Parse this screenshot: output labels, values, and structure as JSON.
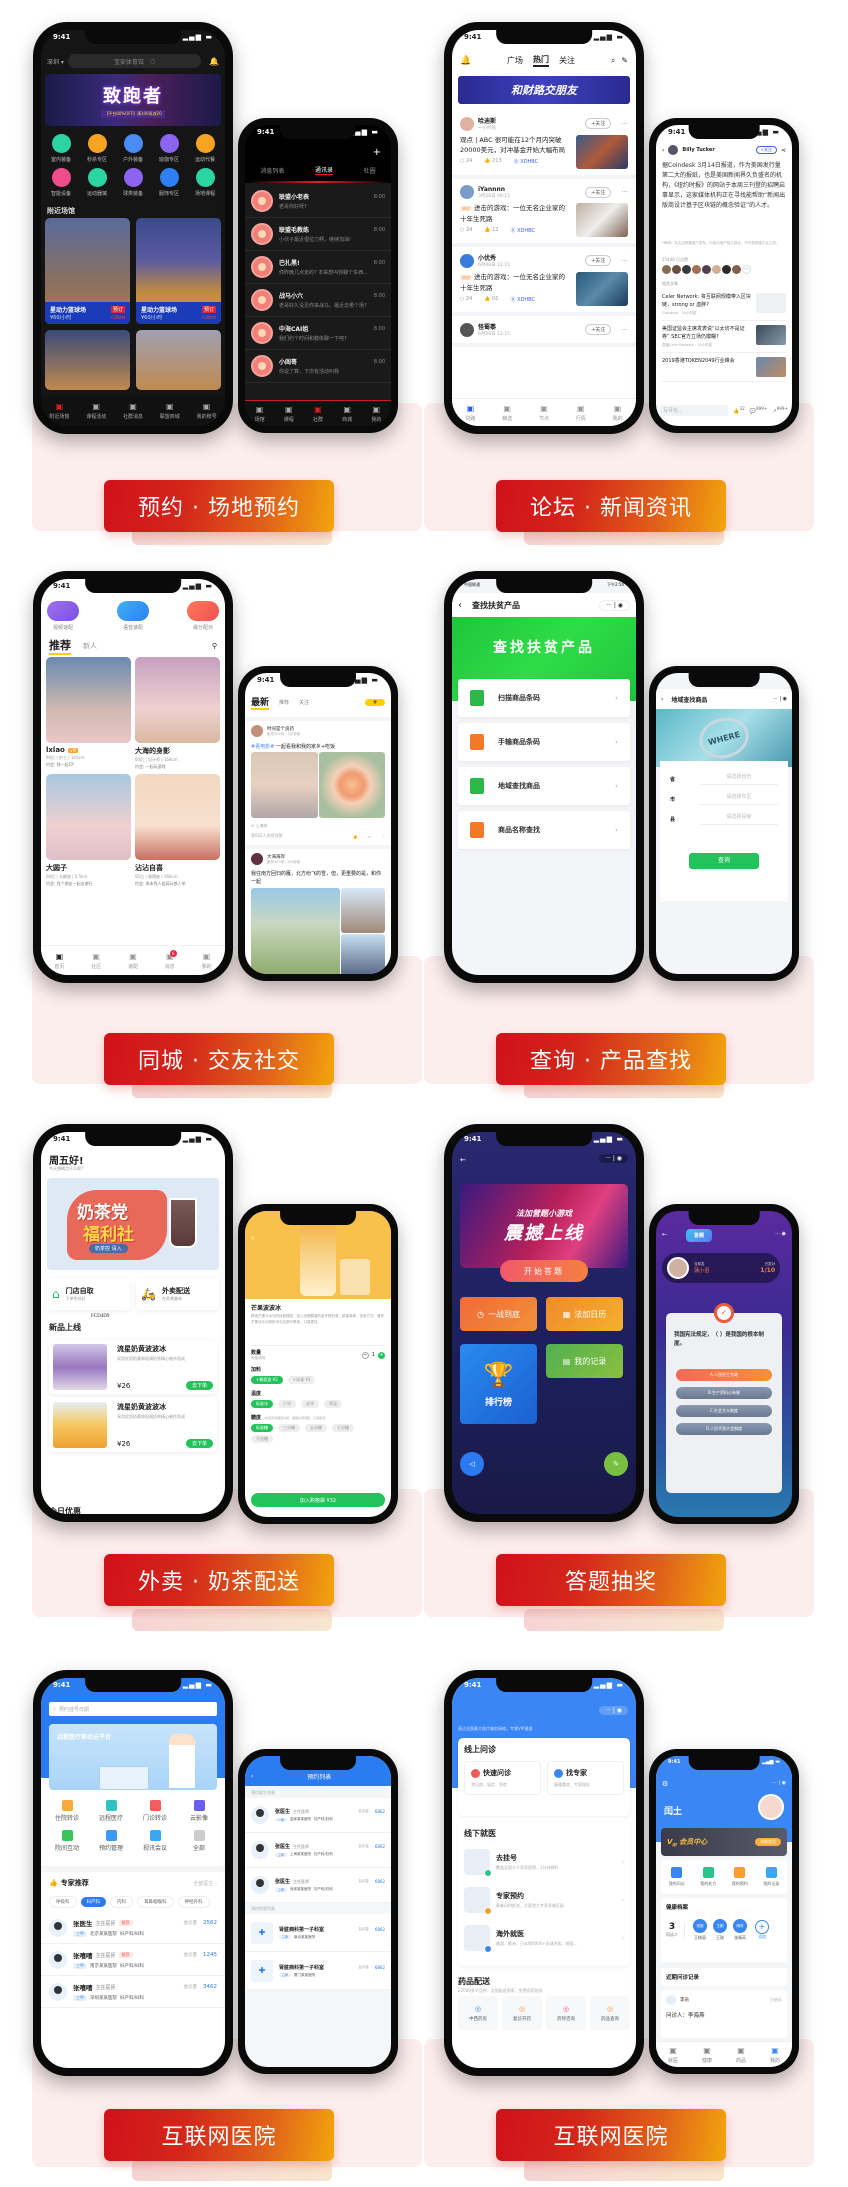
{
  "status_time": "9:41",
  "cards": {
    "booking": {
      "banner_label": "预约 · 场地预约",
      "main": {
        "city": "深圳 ▾",
        "search_placeholder": "宝安体育馆",
        "hero_title": "致跑者",
        "hero_sub": "【平台80%OFF】满100再减20",
        "categories": [
          "室内装备",
          "秒杀专区",
          "户外装备",
          "瑜伽专区",
          "运动代餐",
          "智能设备",
          "运动器械",
          "球类装备",
          "服饰专区",
          "场地课程"
        ],
        "category_colors": [
          "#2bd4a0",
          "#f7a420",
          "#4a8bf5",
          "#8c64f0",
          "#f7a420",
          "#f04b8a",
          "#2bd4a0",
          "#8c64f0",
          "#2f7ef5",
          "#2bd4a0"
        ],
        "section_title": "附近场馆",
        "venues": [
          {
            "name": "星动力篮球场",
            "price": "¥60/小时",
            "badge": "预订",
            "distance": "<2km"
          },
          {
            "name": "星动力篮球场",
            "price": "¥60/小时",
            "badge": "预订",
            "distance": "<2km"
          }
        ],
        "tabs": [
          "附近场馆",
          "课程活动",
          "社群消息",
          "联盟商城",
          "我的账号"
        ]
      },
      "side": {
        "tabs": [
          "消息列表",
          "通讯录",
          "社圈"
        ],
        "messages": [
          {
            "name": "联盟小老表",
            "text": "老哥你好呀?",
            "time": "8:00"
          },
          {
            "name": "联盟毛教练",
            "text": "小伙子最近很拉力啊，继续加油!",
            "time": "8:00"
          },
          {
            "name": "巴扎黑!",
            "text": "你昨晚几点走的? 本来想叫你聊个东西...",
            "time": "8:00"
          },
          {
            "name": "战马小六",
            "text": "老哥好久没见你来战马，最近去哪个场?",
            "time": "8:00"
          },
          {
            "name": "中海CAI姐",
            "text": "我们约个时间和教练聊一下吧?",
            "time": "8:00"
          },
          {
            "name": "小阎哥",
            "text": "你说了算，下次有活动叫我",
            "time": "8:00"
          }
        ],
        "tabs_bottom": [
          "场馆",
          "课程",
          "社群",
          "商城",
          "我的"
        ]
      }
    },
    "news": {
      "banner_label": "论坛 · 新闻资讯",
      "main": {
        "tabs": [
          "广场",
          "热门",
          "关注"
        ],
        "hero_title": "和财路交朋友",
        "follow_label": "+关注",
        "posts": [
          {
            "user": "哈迪斯",
            "time": "一小时前",
            "title": "观点 | ABC 很可能在12个月内突破20000美元，对冲基金开始大幅布局",
            "comments": "24",
            "likes": "213",
            "tag": "XDHBC"
          },
          {
            "user": "iYannnn",
            "time": "3月28日 09:15",
            "title": "进击的游戏：一位无名企业家的十年生死路",
            "label": "原创",
            "comments": "24",
            "likes": "12",
            "tag": "XDHBC"
          },
          {
            "user": "小优秀",
            "time": "6月08日 12:15",
            "title": "进击的游戏：一位无名企业家的十年生死路",
            "label": "原创",
            "comments": "24",
            "likes": "00",
            "tag": "XDHBC"
          },
          {
            "user": "怪蜀黍",
            "time": "6月08日 12:15"
          }
        ],
        "tabs_bottom": [
          "财路",
          "精选",
          "节点",
          "行情",
          "我的"
        ]
      },
      "side": {
        "author": "Billy Tucker",
        "follow_label": "+关注",
        "body": "据Coindesk 3月14日报道，作为美国发行量第二大的报纸，也是美国新闻界久负盛名的机构，《纽约时报》的网站于本周三刊登的招聘启事显示，这家媒体机构正在寻找能帮助“新闻出版商设计基于区块链的概念验证”的人才。",
        "disclaimer": "*声明：本文由财路用户发布，内容为用户独立观点，不代表财路平台立场。",
        "likes_count": "25440 已点赞",
        "related_title": "相关文章",
        "related": [
          {
            "title": "Celer Network: 将互联网规模带入区块链，strong or 虚胖?",
            "meta": "Cloudsun · 10小时前"
          },
          {
            "title": "美国证监会主席发表说“以太坊不是证券” SEC官方立场仍模糊?",
            "meta": "直播Celer Network · 10小时前"
          },
          {
            "title": "2019香港TOKEN2049行业峰会",
            "meta": ""
          }
        ],
        "comment_placeholder": "写评论...",
        "like_count": "32",
        "comment_count": "999+",
        "share_count": "999+"
      }
    },
    "social": {
      "banner_label": "同城 · 交友社交",
      "main": {
        "quick": [
          "视频速配",
          "语音速配",
          "缘分配对"
        ],
        "tabs": [
          "推荐",
          "新人"
        ],
        "profiles": [
          {
            "name": "lxlao",
            "vip": "VIP",
            "info": "90后 | 护士 | 165cm",
            "date": "约会: 找一起CP"
          },
          {
            "name": "大海的身影",
            "info": "00后 | 设计师 | 168cm",
            "date": "约会: 一起玩游戏"
          },
          {
            "name": "大圆子",
            "info": "00后 | 天蝎座 | 0.5km",
            "date": "约会: 找个朋友一起去旅行"
          },
          {
            "name": "沾沾自喜",
            "info": "95后 | 摩羯座 | 166cm",
            "date": "约会: 周末找人组局玩狼人杀"
          }
        ],
        "tabs_bottom": [
          "首页",
          "社区",
          "速配",
          "消息",
          "我的"
        ],
        "message_badge": "6"
      },
      "side": {
        "tabs": [
          "最新",
          "推荐",
          "关注"
        ],
        "post1": {
          "user": "时间是个良药",
          "meta": "距您300米 · 3分钟前",
          "hashtag": "#看电影#",
          "text": "一起看我和我的家乡+吃饭",
          "location": "上海市",
          "likes": "等602人觉得很赞"
        },
        "post2": {
          "user": "大海海岸",
          "meta": "距你403米 · 4分钟前",
          "text": "我往南方回归的雁，北方纷飞的雪，但，更重要的是，和你一起"
        }
      }
    },
    "search": {
      "banner_label": "查询 · 产品查找",
      "main": {
        "carrier": "中国联通",
        "clock": "下午2:56",
        "title": "查找扶贫产品",
        "hero": "查找扶贫产品",
        "items": [
          {
            "label": "扫描商品条码",
            "color": "#2db84a"
          },
          {
            "label": "手输商品条码",
            "color": "#f07a2a"
          },
          {
            "label": "地域查找商品",
            "color": "#2db84a"
          },
          {
            "label": "商品名称查找",
            "color": "#f07a2a"
          }
        ]
      },
      "side": {
        "title": "地域查找商品",
        "hero_text": "WHERE",
        "fields": [
          {
            "label": "省",
            "placeholder": "请选择省份"
          },
          {
            "label": "市",
            "placeholder": "请选择市区"
          },
          {
            "label": "县",
            "placeholder": "请选择县级"
          }
        ],
        "submit": "查询"
      }
    },
    "milktea": {
      "banner_label": "外卖 · 奶茶配送",
      "main": {
        "greeting": "周五好!",
        "sub": "今天想喝点什么呢?",
        "hero_line1": "奶茶党",
        "hero_line2": "福利社",
        "hero_btn": "奶茶控 请入",
        "services": [
          {
            "title": "门店自取",
            "sub": "下单免排队"
          },
          {
            "title": "外卖配送",
            "sub": "在家喝美味"
          }
        ],
        "code": "FCD4D9",
        "new_title": "新品上线",
        "products": [
          {
            "name": "流星奶黄波波冰",
            "desc": "采用优质奶黄和现调奶茶精心制作而成",
            "price": "¥26",
            "cta": "去下单"
          },
          {
            "name": "流星奶黄波波冰",
            "desc": "采用优质奶黄和现调奶茶精心制作而成",
            "price": "¥26",
            "cta": "去下单"
          }
        ],
        "today_title": "今日优惠"
      },
      "side": {
        "name": "芒果波波冰",
        "desc": "精选芒果与冰沙的经典搭配，加入浓郁醇香的茅牙鲜奶底，甜蜜味美，饮用方式：搅拌芒果冰沙与鲜奶均匀后即可享用，口感更佳。",
        "qty_label": "数量",
        "qty_sub": "规格说明",
        "qty": "1",
        "addon_label": "加料",
        "addons": [
          "+椰浆波 ¥2",
          "+珍珠 ¥3"
        ],
        "temp_label": "温度",
        "temps": [
          "标准冰",
          "少冰",
          "去冰",
          "常温"
        ],
        "sugar_label": "糖度",
        "sugar_note": "(本店所有糖度均按，酸甜比例调配，口感更佳)",
        "sugars": [
          "标准糖",
          "三分糖",
          "五分糖",
          "七分糖",
          "不加糖"
        ],
        "cart": "加入购物袋 ¥32"
      }
    },
    "quiz": {
      "banner_label": "答题抽奖",
      "main": {
        "hero_small": "法加营题小游戏",
        "hero_big": "震撼上线",
        "start": "开始答题",
        "tiles": [
          "一战到底",
          "法加日历",
          "排行榜",
          "我的记录"
        ]
      },
      "side": {
        "header": "答题",
        "user_label": "当前答",
        "user_name": "蒲小泪",
        "progress_label": "已答对",
        "progress": "1/10",
        "question": "我国宪法规定，（ ）是我国的根本制度。",
        "options": [
          "A.人民民主专政",
          "B.生产资料公有制",
          "C.社会主义制度",
          "D.人民代表大会制度"
        ]
      }
    },
    "hospital1": {
      "banner_label": "互联网医院",
      "main": {
        "search_placeholder": "预约挂号日期",
        "hero_title": "远程医疗移动云平台",
        "services": [
          "住院转诊",
          "远程医疗",
          "门诊转诊",
          "云影像",
          "院间互动",
          "预约管理",
          "视讯会议",
          "全部"
        ],
        "service_colors": [
          "#f7a93b",
          "#2ec4c4",
          "#f25e5e",
          "#6a5ef0",
          "#3cc35a",
          "#3a9af5",
          "#3aa7f0",
          "#cccccc"
        ],
        "expert_title": "专家推荐",
        "all_link": "全部医生",
        "departments": [
          "呼吸科",
          "妇产科",
          "内科",
          "耳鼻咽喉科",
          "神经外科"
        ],
        "doctors": [
          {
            "name": "张医生",
            "title": "主任医师",
            "tag": "推荐",
            "count_label": "会诊量",
            "count": "2562",
            "level": "三甲",
            "hospital": "北京某某医院",
            "dept": "妇产科/妇科"
          },
          {
            "name": "张嘻嘻",
            "title": "主任医师",
            "tag": "推荐",
            "count_label": "会诊量",
            "count": "1245",
            "level": "三甲",
            "hospital": "南京某某医院",
            "dept": "妇产科/妇科"
          },
          {
            "name": "张嘻嘻",
            "title": "主任医师",
            "count_label": "会诊量",
            "count": "3462",
            "level": "三甲",
            "hospital": "深圳某某医院",
            "dept": "妇产科/妇科"
          }
        ]
      },
      "side": {
        "title": "预约列表",
        "doctor_section": "预约医生列表",
        "doctors": [
          {
            "name": "张医生",
            "title": "主任医师",
            "count": "6862",
            "level": "一甲",
            "hospital": "金家某某医院",
            "dept": "妇产科/妇科"
          },
          {
            "name": "张医生",
            "title": "主任医师",
            "count": "6862",
            "level": "三甲",
            "hospital": "上海某某医院",
            "dept": "妇产科/妇科"
          },
          {
            "name": "张医生",
            "title": "主任医师",
            "count": "6862",
            "level": "三甲",
            "hospital": "深圳某某医院",
            "dept": "妇产科/妇科"
          }
        ],
        "room_section": "预约科室列表",
        "rooms": [
          {
            "name": "肾脏病科第一子科室",
            "count": "6862",
            "level": "三甲",
            "hospital": "南京某某医院"
          },
          {
            "name": "肾脏病科第一子科室",
            "count": "6862",
            "level": "三甲",
            "hospital": "厦门某某医院"
          }
        ],
        "count_label": "会诊量"
      }
    },
    "hospital2": {
      "banner_label": "互联网医院",
      "main": {
        "tagline": "直达全国最大医疗服务网络，专属VIP通道",
        "online_title": "线上问诊",
        "online": [
          {
            "title": "快速问诊",
            "sub": "常见病、轻症、急症"
          },
          {
            "title": "找专家",
            "sub": "疑难重症、专家指导"
          }
        ],
        "offline_title": "线下就医",
        "offline": [
          {
            "title": "去挂号",
            "sub": "覆盖全国七千多家医院，1分钟预约"
          },
          {
            "title": "专家预约",
            "sub": "患者印时把关，大医院大专家多维匹配"
          },
          {
            "title": "海外就医",
            "sub": "美国、欧洲、日本等6000+全球名医，跨国..."
          }
        ],
        "pharmacy_title": "药品配送",
        "pharmacy_sub": "22000多个品种、全国配送到家、免费用药指导",
        "pharmacy": [
          "中西药房",
          "复诊开药",
          "药师咨询",
          "药品查询"
        ]
      },
      "side": {
        "user": "闰土",
        "vip": "会员中心",
        "vip_btn": "兑换会员",
        "shortcuts": [
          "我的问诊",
          "我的处方",
          "我的预约",
          "我的记录"
        ],
        "health_title": "健康档案",
        "patients_count": "3",
        "patients_label": "问诊人",
        "patients": [
          "王桃丽",
          "王刚",
          "张晴芮"
        ],
        "add_label": "添加",
        "recent_title": "近期问诊记录",
        "record_doctor": "李员",
        "record_status": "已结诊",
        "record_patient": "问诊人：李海燕",
        "tabs_bottom": [
          "就医",
          "健康",
          "药品",
          "我的"
        ]
      }
    }
  }
}
